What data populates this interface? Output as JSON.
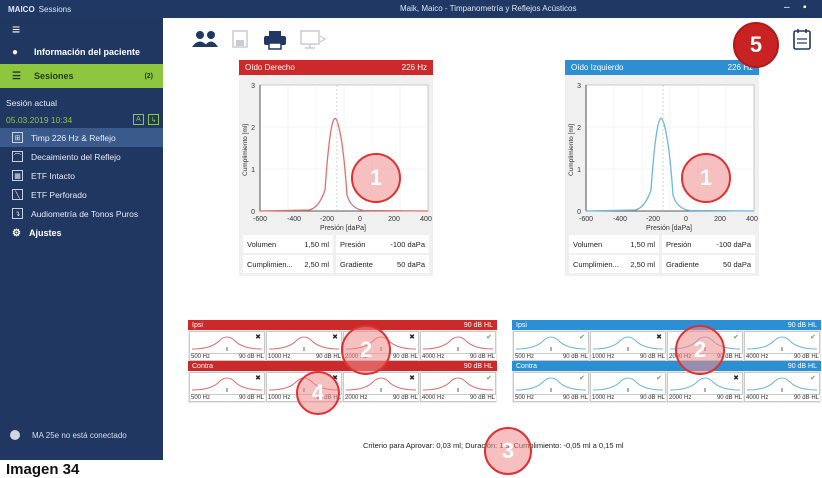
{
  "window": {
    "brand": "MAICO",
    "app_name": "Sessions",
    "title": "Maik, Maico - Timpanometría y Reflejos Acústicos",
    "controls": [
      "–",
      "▪"
    ]
  },
  "sidebar": {
    "menu_icon": "hamburger-icon",
    "patient_info": "Información del paciente",
    "sessions": "Sesiones",
    "sessions_count": "(2)",
    "current_session": "Sesión actual",
    "session_date": "05.03.2019 10:34",
    "tests": [
      {
        "label": "Timp 226 Hz & Reflejo",
        "active": true
      },
      {
        "label": "Decaimiento del Reflejo",
        "active": false
      },
      {
        "label": "ETF Intacto",
        "active": false
      },
      {
        "label": "ETF Perforado",
        "active": false
      },
      {
        "label": "Audiometría de Tonos Puros",
        "active": false
      }
    ],
    "settings": "Ajustes",
    "device_status": "MA 25e no está conectado"
  },
  "toolbar": {
    "icons": [
      "patients-icon",
      "save-icon",
      "print-icon",
      "monitor-icon",
      "calendar-icon"
    ]
  },
  "right_ear": {
    "label": "Oído Derecho",
    "freq": "226 Hz",
    "color": "#cc2a2a",
    "volume_label": "Volumen",
    "volume": "1,50 ml",
    "pressure_label": "Presión",
    "pressure": "-100 daPa",
    "compliance_label": "Cumplimien...",
    "compliance": "2,50 ml",
    "gradient_label": "Gradiente",
    "gradient": "50 daPa"
  },
  "left_ear": {
    "label": "Oído Izquierdo",
    "freq": "226 Hz",
    "color": "#2c8fd4",
    "volume_label": "Volumen",
    "volume": "1,50 ml",
    "pressure_label": "Presión",
    "pressure": "-100 daPa",
    "compliance_label": "Cumplimien...",
    "compliance": "2,50 ml",
    "gradient_label": "Gradiente",
    "gradient": "50 daPa"
  },
  "tympanogram": {
    "xlabel": "Presión [daPa]",
    "ylabel": "Cumplimiento [ml]",
    "xticks": [
      "-600",
      "-400",
      "-200",
      "0",
      "200",
      "400"
    ],
    "yticks": [
      "0",
      "1",
      "2",
      "3"
    ]
  },
  "reflex": {
    "ipsi_label": "Ipsi",
    "contra_label": "Contra",
    "level": "90 dB HL",
    "freqs": [
      "500 Hz",
      "1000 Hz",
      "2000 Hz",
      "4000 Hz"
    ],
    "right_ipsi_marks": [
      "✖",
      "✖",
      "✖",
      "✔"
    ],
    "right_contra_marks": [
      "✖",
      "✖",
      "✖",
      "✔"
    ],
    "left_ipsi_marks": [
      "✔",
      "✖",
      "✔",
      "✔"
    ],
    "left_contra_marks": [
      "✔",
      "✔",
      "✖",
      "✔"
    ]
  },
  "criteria": "Criterio para Aprovar: 0,03 ml; Duración: 1 s; Cumplimiento: -0,05 ml a 0,15 ml",
  "badges": [
    "1",
    "1",
    "2",
    "2",
    "3",
    "4",
    "5"
  ],
  "caption": "Imagen 34"
}
